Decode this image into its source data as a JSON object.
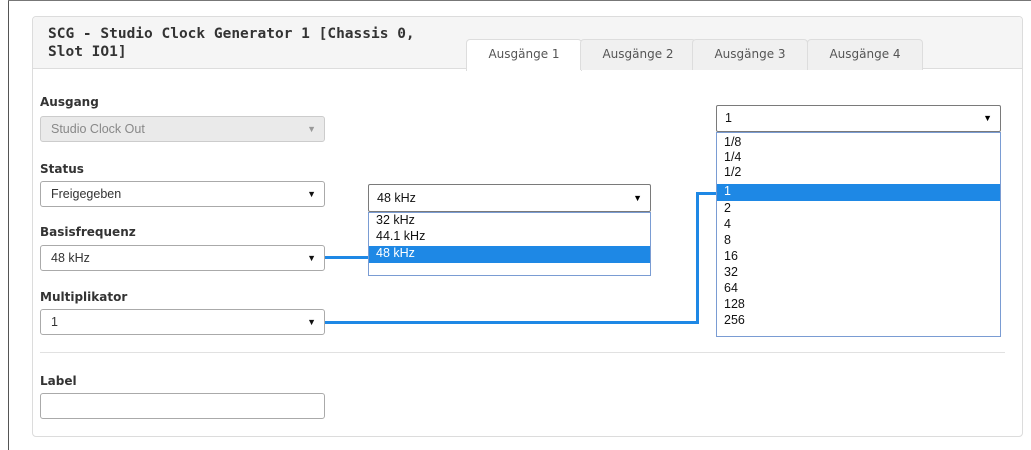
{
  "panel": {
    "title_line1": "SCG - Studio Clock Generator 1 [Chassis 0,",
    "title_line2": "Slot IO1]"
  },
  "tabs": [
    {
      "label": "Ausgänge 1",
      "active": true
    },
    {
      "label": "Ausgänge 2",
      "active": false
    },
    {
      "label": "Ausgänge 3",
      "active": false
    },
    {
      "label": "Ausgänge 4",
      "active": false
    }
  ],
  "form": {
    "ausgang": {
      "label": "Ausgang",
      "value": "Studio Clock Out"
    },
    "status": {
      "label": "Status",
      "value": "Freigegeben"
    },
    "basisfrequenz": {
      "label": "Basisfrequenz",
      "value": "48 kHz"
    },
    "multiplikator": {
      "label": "Multiplikator",
      "value": "1"
    },
    "label_field": {
      "label": "Label",
      "value": ""
    }
  },
  "frequency_dropdown": {
    "selected": "48 kHz",
    "options": [
      "32 kHz",
      "44.1 kHz",
      "48 kHz"
    ]
  },
  "multiplier_dropdown": {
    "selected": "1",
    "options": [
      "1/8",
      "1/4",
      "1/2",
      "1",
      "2",
      "4",
      "8",
      "16",
      "32",
      "64",
      "128",
      "256"
    ]
  },
  "icons": {
    "caret": "▼"
  },
  "colors": {
    "accent": "#1e88e5",
    "header_bg": "#f5f5f5",
    "disabled_bg": "#eaeaea"
  }
}
